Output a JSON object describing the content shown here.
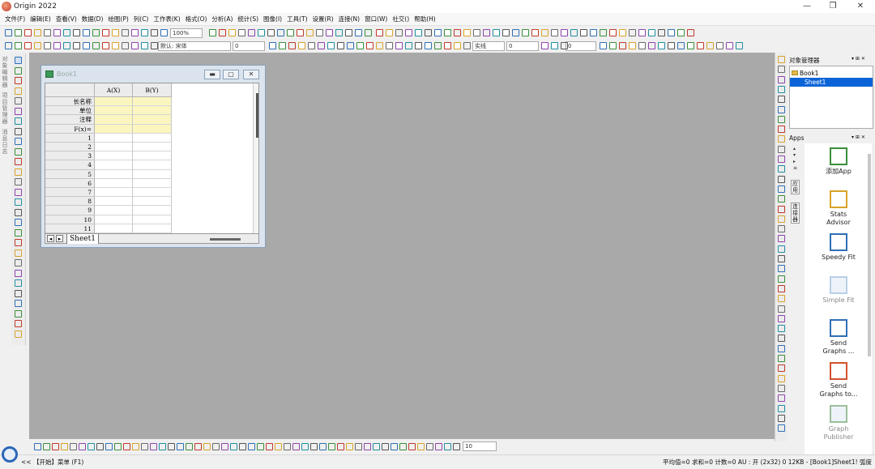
{
  "window": {
    "title": "Origin 2022",
    "minimize": "—",
    "maximize": "❐",
    "close": "✕"
  },
  "menu": [
    "文件(F)",
    "编辑(E)",
    "查看(V)",
    "数据(D)",
    "绘图(P)",
    "列(C)",
    "工作表(K)",
    "格式(O)",
    "分析(A)",
    "统计(S)",
    "图像(I)",
    "工具(T)",
    "设置(R)",
    "连接(N)",
    "窗口(W)",
    "社交()",
    "帮助(H)"
  ],
  "toolbar1": {
    "zoom_value": "100%"
  },
  "toolbar2": {
    "font_name": "默认: 宋体",
    "font_size": "0",
    "size2": "0",
    "line_style": "实线",
    "size3": "0",
    "size4": "0"
  },
  "left_strip": [
    "对象编辑器",
    "项目管理器",
    "消息日志"
  ],
  "book": {
    "title": "Book1",
    "columns": [
      {
        "label": "A(X)"
      },
      {
        "label": "B(Y)"
      }
    ],
    "meta_rows": [
      "长名称",
      "单位",
      "注释",
      "F(x)="
    ],
    "data_rows": [
      "1",
      "2",
      "3",
      "4",
      "5",
      "6",
      "7",
      "8",
      "9",
      "10",
      "11"
    ],
    "tab_label": "Sheet1",
    "tab_nav_left": "◂",
    "tab_nav_right": "▸"
  },
  "object_manager": {
    "title": "对象管理器",
    "pin": "▾ ⊞ ✕",
    "tree": [
      {
        "label": "Book1"
      },
      {
        "label": "Sheet1",
        "selected": true
      }
    ]
  },
  "apps_panel": {
    "title": "Apps",
    "pin": "▾ ⊞ ✕",
    "side_tabs": [
      "应用",
      "连接器"
    ],
    "items": [
      {
        "label_lines": [
          "添加App"
        ],
        "icon": "add-app-icon",
        "dim": false
      },
      {
        "label_lines": [
          "Stats",
          "Advisor"
        ],
        "icon": "stats-advisor-icon",
        "dim": false
      },
      {
        "label_lines": [
          "Speedy Fit"
        ],
        "icon": "speedy-fit-icon",
        "dim": false
      },
      {
        "label_lines": [
          "Simple Fit"
        ],
        "icon": "simple-fit-icon",
        "dim": true
      },
      {
        "label_lines": [
          "Send",
          "Graphs ..."
        ],
        "icon": "send-graphs-word-icon",
        "dim": false
      },
      {
        "label_lines": [
          "Send",
          "Graphs to..."
        ],
        "icon": "send-graphs-ppt-icon",
        "dim": false
      },
      {
        "label_lines": [
          "Graph",
          "Publisher"
        ],
        "icon": "graph-publisher-icon",
        "dim": true
      }
    ]
  },
  "bottom_toolbar": {
    "zoom_field": "10"
  },
  "status": {
    "left": "<< 【开始】菜单 (F1)",
    "right": "平均值=0 求和=0 计数=0    AU : 开    (2x32) 0 12KB - [Book1]Sheet1! 弧度"
  },
  "colors": {
    "workspace": "#a9a9a9",
    "selection": "#0a64d8",
    "cell_yellow": "#fbf6c0"
  }
}
